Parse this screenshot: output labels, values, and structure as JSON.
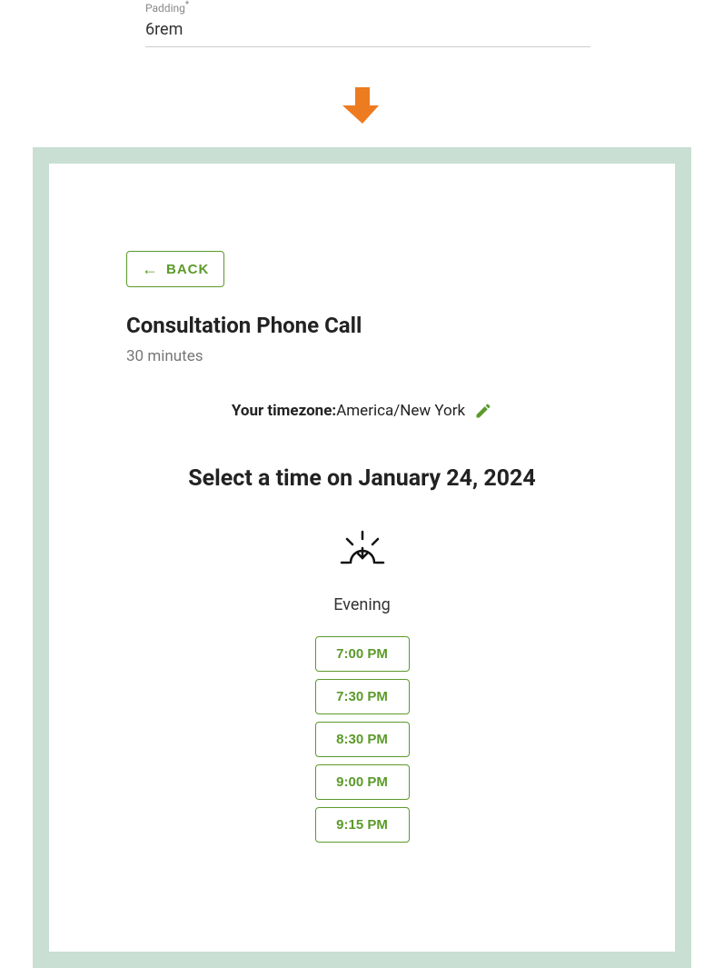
{
  "config": {
    "field_label": "Padding",
    "asterisk": "*",
    "field_value": "6rem"
  },
  "booking": {
    "back_label": "BACK",
    "title": "Consultation Phone Call",
    "duration": "30 minutes",
    "tz_label": "Your timezone:",
    "tz_value": "America/New York",
    "select_heading": "Select a time on January 24, 2024",
    "period_label": "Evening",
    "slots": [
      "7:00 PM",
      "7:30 PM",
      "8:30 PM",
      "9:00 PM",
      "9:15 PM"
    ]
  },
  "colors": {
    "accent_green": "#5b9a2a",
    "frame_border": "#c9dfd3",
    "arrow_orange": "#ed7b1f"
  }
}
